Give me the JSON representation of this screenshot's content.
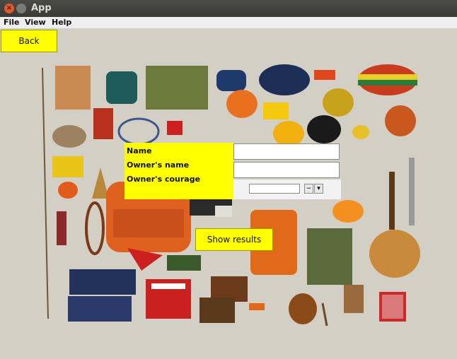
{
  "window": {
    "title": "App",
    "close_glyph": "×"
  },
  "menu": {
    "items": [
      "File",
      "View",
      "Help"
    ]
  },
  "buttons": {
    "back": "Back",
    "show_results": "Show results"
  },
  "form": {
    "labels": [
      "Name",
      "Owner's name",
      "Owner's courage"
    ],
    "name_value": "",
    "owner_name_value": "",
    "courage_value": "",
    "spinner_down": "−",
    "spinner_dropdown": "▾"
  },
  "colors": {
    "accent": "#ffff00"
  }
}
